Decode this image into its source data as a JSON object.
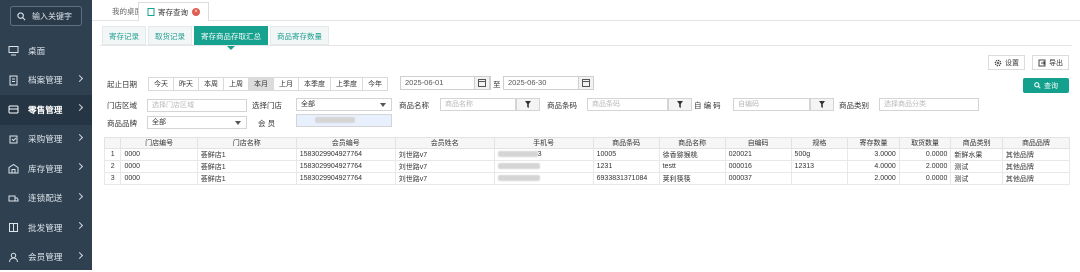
{
  "search": {
    "placeholder": "输入关键字"
  },
  "sidebar": {
    "items": [
      {
        "label": "桌面",
        "icon": "desktop-icon"
      },
      {
        "label": "档案管理",
        "icon": "file-icon"
      },
      {
        "label": "零售管理",
        "icon": "cart-icon"
      },
      {
        "label": "采购管理",
        "icon": "purchase-icon"
      },
      {
        "label": "库存管理",
        "icon": "warehouse-icon"
      },
      {
        "label": "连锁配送",
        "icon": "delivery-icon"
      },
      {
        "label": "批发管理",
        "icon": "wholesale-icon"
      },
      {
        "label": "会员管理",
        "icon": "member-icon"
      }
    ]
  },
  "page_tabs": {
    "home": "我的桌面",
    "current": "寄存查询"
  },
  "sub_tabs": [
    "寄存记录",
    "取货记录",
    "寄存商品存取汇总",
    "商品寄存数量"
  ],
  "toolbar": {
    "settings": "设置",
    "export": "导出",
    "query": "查询"
  },
  "filters": {
    "date_label": "起止日期",
    "ranges": [
      "今天",
      "昨天",
      "本周",
      "上周",
      "本月",
      "上月",
      "本季度",
      "上季度",
      "今年"
    ],
    "selected_range": "本月",
    "start_date": "2025-06-01",
    "to": "至",
    "end_date": "2025-06-30",
    "store_area_label": "门店区域",
    "store_area_placeholder": "选择门店区域",
    "store_label": "选择门店",
    "store_value": "全部",
    "product_name_label": "商品名称",
    "product_name_placeholder": "商品名称",
    "barcode_label": "商品条码",
    "barcode_placeholder": "商品条码",
    "selfcode_label": "自 编 码",
    "selfcode_placeholder": "自编码",
    "category_label": "商品类别",
    "category_placeholder": "选择商品分类",
    "brand_label": "商品品牌",
    "brand_value": "全部",
    "member_label": "会 员"
  },
  "table": {
    "headers": [
      "门店编号",
      "门店名称",
      "会员编号",
      "会员姓名",
      "手机号",
      "商品条码",
      "商品名称",
      "自编码",
      "规格",
      "寄存数量",
      "取货数量",
      "商品类别",
      "商品品牌"
    ],
    "rows": [
      {
        "no": "1",
        "cells": [
          "0000",
          "荟鲜店1",
          "1583029904927764",
          "刘世路v7",
          "3",
          "10005",
          "徐香猕猴桃",
          "020021",
          "500g",
          "3.0000",
          "0.0000",
          "新鲜水果",
          "其他品牌"
        ]
      },
      {
        "no": "2",
        "cells": [
          "0000",
          "荟鲜店1",
          "1583029904927764",
          "刘世路v7",
          "",
          "1231",
          "testt",
          "000016",
          "12313",
          "4.0000",
          "2.0000",
          "测试",
          "其他品牌"
        ]
      },
      {
        "no": "3",
        "cells": [
          "0000",
          "荟鲜店1",
          "1583029904927764",
          "刘世路v7",
          "",
          "6933831371084",
          "荚利筷筷",
          "000037",
          "",
          "2.0000",
          "0.0000",
          "测试",
          "其他品牌"
        ]
      }
    ]
  }
}
